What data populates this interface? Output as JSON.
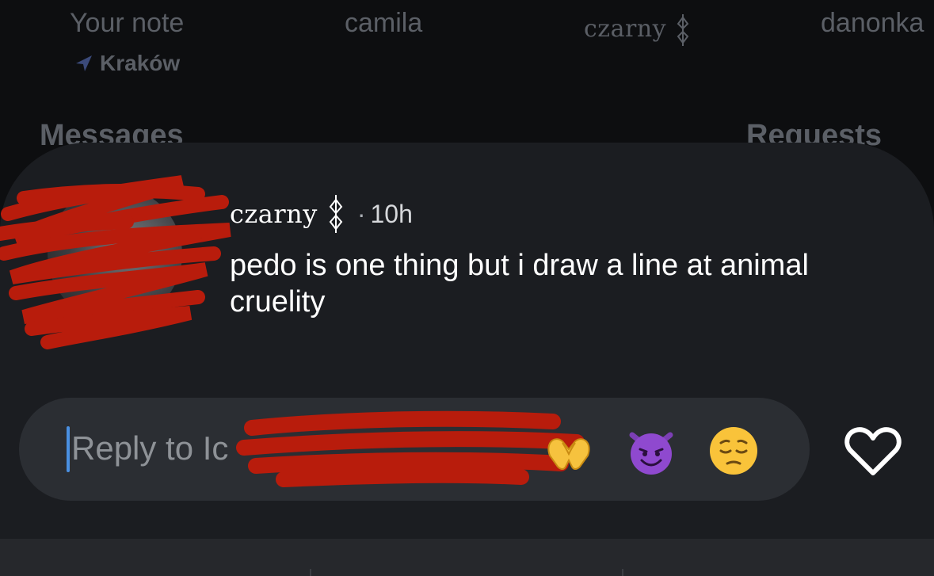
{
  "notes": {
    "your_note": "Your note",
    "location": "Kraków",
    "users": [
      "camila",
      "czarny",
      "danonka"
    ]
  },
  "sections": {
    "messages": "Messages",
    "requests": "Requests"
  },
  "message": {
    "username": "czarny",
    "separator": "·",
    "time": "10h",
    "text": "pedo is one thing but i draw a line at animal cruelity"
  },
  "reply": {
    "placeholder": "Reply to Ic",
    "quick_reactions": [
      "heart-hands-emoji",
      "smiling-devil-emoji",
      "pensive-face-emoji"
    ],
    "like_icon": "heart-outline-icon"
  },
  "colors": {
    "card": "#1b1d21",
    "reply_bar": "#2b2e33",
    "redaction": "#b81c0c",
    "caret": "#4a90e2"
  }
}
